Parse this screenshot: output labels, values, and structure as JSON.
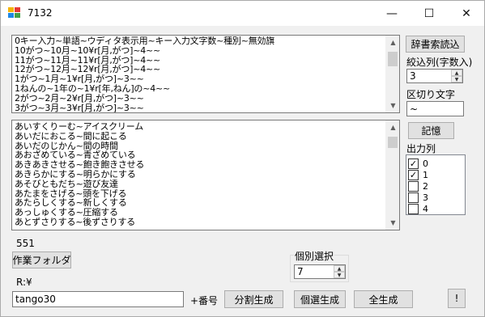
{
  "window": {
    "title": "7132",
    "minimize_icon": "minimize-icon",
    "maximize_icon": "maximize-icon",
    "close_icon": "close-icon",
    "minimize_glyph": "—",
    "maximize_glyph": "☐",
    "close_glyph": "✕"
  },
  "top_list": {
    "items": [
      "0キー入力~単語~ウディタ表示用~キー入力文字数~種別~無効旗",
      "10がつ~10月~10¥r[月,がつ]~4~~",
      "11がつ~11月~11¥r[月,がつ]~4~~",
      "12がつ~12月~12¥r[月,がつ]~4~~",
      "1がつ~1月~1¥r[月,がつ]~3~~",
      "1ねんの~1年の~1¥r[年,ねん]の~4~~",
      "2がつ~2月~2¥r[月,がつ]~3~~",
      "3がつ~3月~3¥r[月,がつ]~3~~"
    ]
  },
  "bottom_list": {
    "items": [
      "あいすくりーむ~アイスクリーム",
      "あいだにおこる~間に起こる",
      "あいだのじかん~間の時間",
      "あおざめている~青ざめている",
      "あきあきさせる~飽き飽きさせる",
      "あきらかにする~明らかにする",
      "あそびともだち~遊び友達",
      "あたまをさげる~頭を下げる",
      "あたらしくする~新しくする",
      "あっしゅくする~圧縮する",
      "あとずさりする~後ずさりする"
    ]
  },
  "right_panel": {
    "load_dict_button": "辞書索読込",
    "filter_label": "絞込列(字数入)",
    "filter_value": "3",
    "delimiter_label": "区切り文字",
    "delimiter_value": "~",
    "remember_button": "記憶",
    "output_columns_label": "出力列",
    "output_columns": [
      {
        "label": "0",
        "checked": true
      },
      {
        "label": "1",
        "checked": true
      },
      {
        "label": "2",
        "checked": false
      },
      {
        "label": "3",
        "checked": false
      },
      {
        "label": "4",
        "checked": false
      }
    ]
  },
  "status": {
    "count": "551",
    "work_folder_button": "作業フォルダ",
    "path_label": "R:¥"
  },
  "individual": {
    "label": "個別選択",
    "value": "7"
  },
  "bottom_bar": {
    "filename_value": "tango30",
    "number_suffix_label": "+番号",
    "split_button": "分割生成",
    "individual_button": "個選生成",
    "all_button": "全生成",
    "alert_button": "!"
  }
}
